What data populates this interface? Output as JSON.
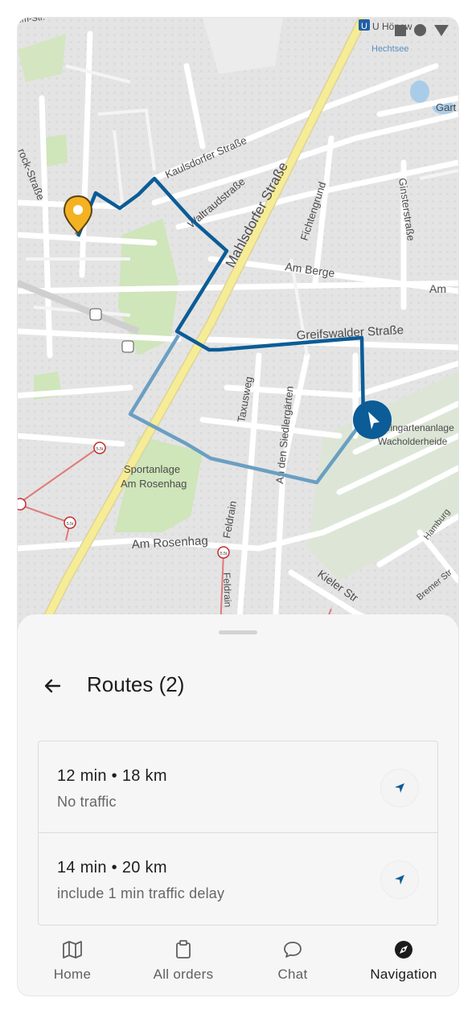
{
  "map": {
    "labels": {
      "subway": "U Hönow",
      "lake": "Hechtsee",
      "kaulsdorfer": "Kaulsdorfer Straße",
      "waltraud": "Waltraudstraße",
      "mahlsdorfer": "Mahlsdorfer Straße",
      "fichtengrund": "Fichtengrund",
      "ginster": "Ginsterstraße",
      "amberge": "Am Berge",
      "am": "Am",
      "garten": "Gart",
      "rock": "rock-Straße",
      "topstr": "Im-Str.",
      "greifswalder": "Greifswalder Straße",
      "taxus": "Taxusweg",
      "siedler": "An den Siedlergärten",
      "feldrain": "Feldrain",
      "feldrain2": "Feldrain",
      "sport1": "Sportanlage",
      "sport2": "Am Rosenhag",
      "rosenhag": "Am Rosenhag",
      "kleingarten1": "Kleingartenanlage",
      "kleingarten2": "Wacholderheide",
      "kieler": "Kieler Str",
      "hamburg": "Hamburg",
      "bremer": "Bremer Str",
      "speed": "5.5t"
    },
    "colors": {
      "route_primary": "#0b5c97",
      "route_alternate": "#6a9fc2",
      "main_road": "#f6ec96",
      "park": "#cce5b5",
      "destination_pin": "#f4b223"
    }
  },
  "sheet": {
    "title": "Routes (2)",
    "back_icon": "arrow-left-icon"
  },
  "routes": [
    {
      "summary": "12 min • 18 km",
      "detail": "No traffic",
      "icon": "navigation-arrow-icon"
    },
    {
      "summary": "14 min • 20 km",
      "detail": "include 1 min traffic delay",
      "icon": "navigation-arrow-icon"
    }
  ],
  "nav": {
    "items": [
      {
        "label": "Home",
        "icon": "map-icon"
      },
      {
        "label": "All orders",
        "icon": "clipboard-icon"
      },
      {
        "label": "Chat",
        "icon": "chat-bubble-icon"
      },
      {
        "label": "Navigation",
        "icon": "compass-icon"
      }
    ],
    "active": "Navigation"
  }
}
